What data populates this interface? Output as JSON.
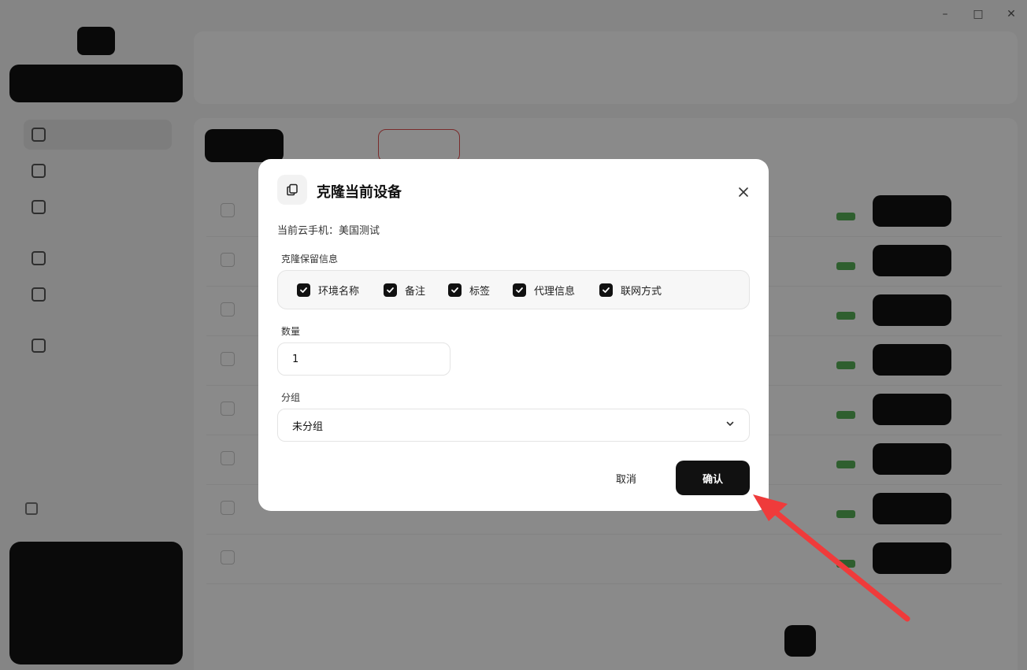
{
  "modal": {
    "title": "克隆当前设备",
    "device_line": "当前云手机：美国测试",
    "retain_label": "克隆保留信息",
    "options": [
      {
        "label": "环境名称",
        "checked": true
      },
      {
        "label": "备注",
        "checked": true
      },
      {
        "label": "标签",
        "checked": true
      },
      {
        "label": "代理信息",
        "checked": true
      },
      {
        "label": "联网方式",
        "checked": true
      }
    ],
    "quantity_label": "数量",
    "quantity_value": "1",
    "group_label": "分组",
    "group_value": "未分组",
    "cancel_label": "取消",
    "confirm_label": "确认"
  },
  "colors": {
    "overlay": "rgba(0,0,0,0.46)",
    "primary": "#111111",
    "annotation_arrow": "#ef3b3b"
  },
  "icons": {
    "header": "copy-icon",
    "close": "close-icon",
    "checkbox": "check-icon",
    "select": "chevron-down-icon"
  }
}
